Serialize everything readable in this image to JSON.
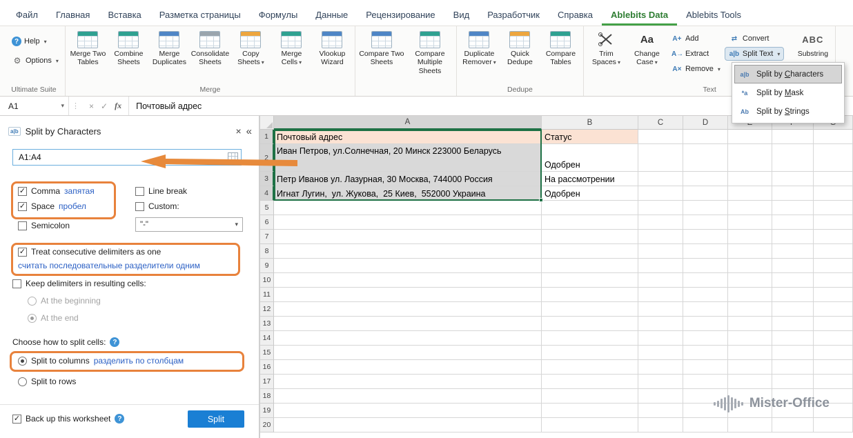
{
  "ribbon": {
    "tabs": [
      "Файл",
      "Главная",
      "Вставка",
      "Разметка страницы",
      "Формулы",
      "Данные",
      "Рецензирование",
      "Вид",
      "Разработчик",
      "Справка",
      "Ablebits Data",
      "Ablebits Tools"
    ],
    "active_tab": "Ablebits Data",
    "ultimate_suite": {
      "label": "Ultimate Suite",
      "help": "Help",
      "options": "Options"
    },
    "merge_group": {
      "label": "Merge",
      "buttons": [
        "Merge Two Tables",
        "Combine Sheets",
        "Merge Duplicates",
        "Consolidate Sheets",
        "Copy Sheets",
        "Merge Cells",
        "Vlookup Wizard"
      ]
    },
    "compare_group": {
      "label": "",
      "buttons": [
        "Compare Two Sheets",
        "Compare Multiple Sheets"
      ]
    },
    "dedupe_group": {
      "label": "Dedupe",
      "buttons": [
        "Duplicate Remover",
        "Quick Dedupe",
        "Compare Tables"
      ]
    },
    "text_group": {
      "label": "Text",
      "trim_spaces": "Trim Spaces",
      "change_case": "Change Case",
      "add": "Add",
      "extract": "Extract",
      "remove": "Remove",
      "convert": "Convert",
      "split_text": "Split Text",
      "substring": "Substring"
    }
  },
  "split_text_menu": {
    "items": [
      {
        "icon": "a|b",
        "pre": "Split by ",
        "key": "C",
        "post": "haracters",
        "selected": true
      },
      {
        "icon": "*a",
        "pre": "Split by ",
        "key": "M",
        "post": "ask",
        "selected": false
      },
      {
        "icon": "Ab",
        "pre": "Split by ",
        "key": "S",
        "post": "trings",
        "selected": false
      }
    ]
  },
  "formula_bar": {
    "name_box": "A1",
    "formula": "Почтовый адрес"
  },
  "icons": {
    "help": "?",
    "gear": "⚙",
    "caret_down": "▾",
    "close": "×",
    "collapse": "«",
    "cancel": "×",
    "enter": "✓",
    "fx": "fx",
    "grip": "⋮",
    "convert": "⇄",
    "add": "A+",
    "extract": "A→",
    "remove": "A×",
    "change_case": "Aa",
    "substring": "ABC",
    "pane": "a|b",
    "question": "?"
  },
  "panel": {
    "title": "Split by Characters",
    "range_value": "A1:A4",
    "delimiters": {
      "comma": {
        "label": "Comma",
        "hint": "запятая",
        "checked": true
      },
      "space": {
        "label": "Space",
        "hint": "пробел",
        "checked": true
      },
      "semicolon": {
        "label": "Semicolon",
        "checked": false
      },
      "line_break": {
        "label": "Line break",
        "checked": false
      },
      "custom": {
        "label": "Custom:",
        "checked": false,
        "value": "\"-\""
      }
    },
    "treat_consecutive": {
      "label": "Treat consecutive delimiters as one",
      "hint": "считать последовательные разделители одним",
      "checked": true
    },
    "keep_delimiters": {
      "label": "Keep delimiters in resulting cells:",
      "checked": false,
      "options": [
        {
          "label": "At the beginning",
          "selected": false
        },
        {
          "label": "At the end",
          "selected": true
        }
      ]
    },
    "choose_split": {
      "label": "Choose how to split cells:"
    },
    "split_to_columns": {
      "label": "Split to columns",
      "hint": "разделить по столбцам",
      "selected": true
    },
    "split_to_rows": {
      "label": "Split to rows",
      "selected": false
    },
    "backup": {
      "label": "Back up this worksheet",
      "checked": true
    },
    "split_button": "Split"
  },
  "sheet": {
    "columns": [
      "A",
      "B",
      "C",
      "D",
      "E",
      "F",
      "G"
    ],
    "row_count": 20,
    "selection": "A1:A4",
    "cells": [
      {
        "ref": "A1",
        "text": "Почтовый адрес",
        "style": "header"
      },
      {
        "ref": "B1",
        "text": "Статус",
        "style": "header"
      },
      {
        "ref": "A2",
        "text": "Иван Петров, ул.Солнечная, 20 Минск 223000 Беларусь"
      },
      {
        "ref": "B2",
        "text": "Одобрен"
      },
      {
        "ref": "A3",
        "text": "Петр Иванов ул. Лазурная, 30 Москва, 744000 Россия"
      },
      {
        "ref": "B3",
        "text": "На рассмотрении"
      },
      {
        "ref": "A4",
        "text": "Игнат Лугин,  ул. Жукова,  25 Киев,  552000 Украина"
      },
      {
        "ref": "B4",
        "text": "Одобрен"
      }
    ]
  },
  "logo": {
    "text": "Mister-Office"
  }
}
